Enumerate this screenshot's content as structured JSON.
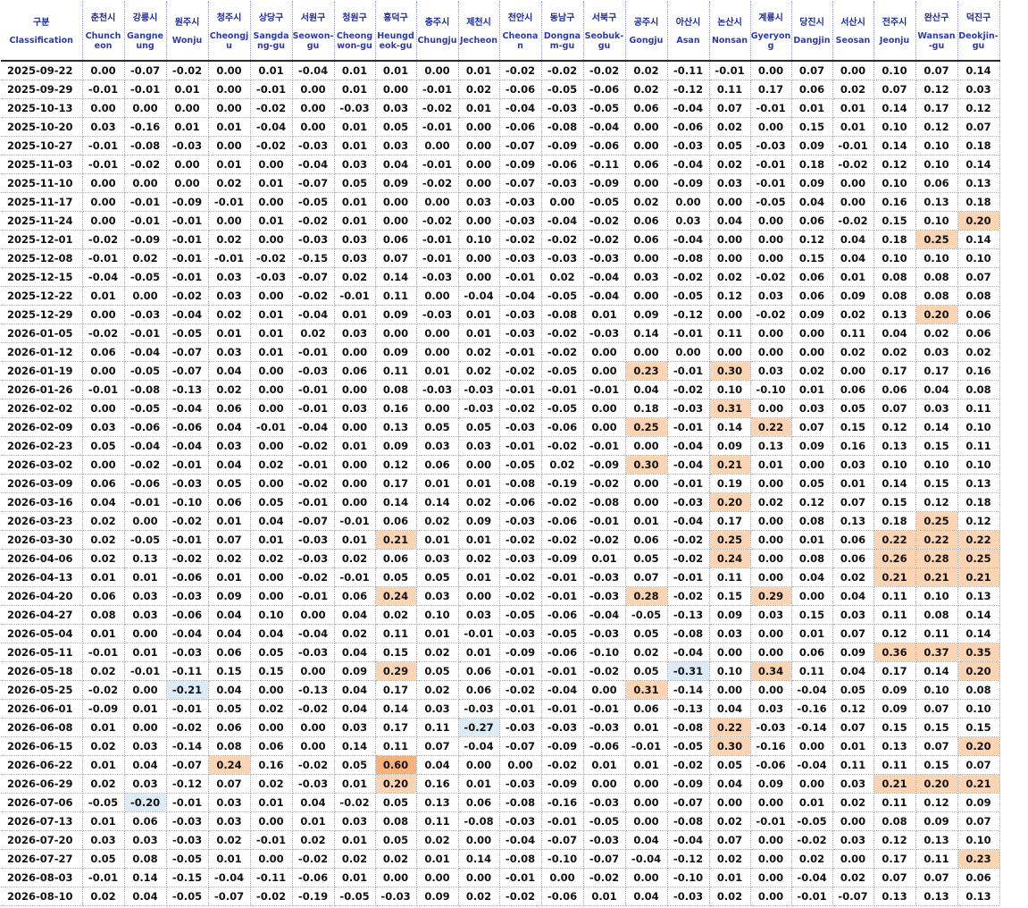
{
  "table": {
    "columns": [
      {
        "ko": "구분",
        "en": "Classification"
      },
      {
        "ko": "춘천시",
        "en": "Chuncheon"
      },
      {
        "ko": "강릉시",
        "en": "Gangneung"
      },
      {
        "ko": "원주시",
        "en": "Wonju"
      },
      {
        "ko": "청주시",
        "en": "Cheongju"
      },
      {
        "ko": "상당구",
        "en": "Sangdang-gu"
      },
      {
        "ko": "서원구",
        "en": "Seowon-gu"
      },
      {
        "ko": "청원구",
        "en": "Cheongwon-gu"
      },
      {
        "ko": "흥덕구",
        "en": "Heungdeok-gu"
      },
      {
        "ko": "충주시",
        "en": "Chungju"
      },
      {
        "ko": "제천시",
        "en": "Jecheon"
      },
      {
        "ko": "천안시",
        "en": "Cheonan"
      },
      {
        "ko": "동남구",
        "en": "Dongnam-gu"
      },
      {
        "ko": "서북구",
        "en": "Seobuk-gu"
      },
      {
        "ko": "공주시",
        "en": "Gongju"
      },
      {
        "ko": "아산시",
        "en": "Asan"
      },
      {
        "ko": "논산시",
        "en": "Nonsan"
      },
      {
        "ko": "계룡시",
        "en": "Gyeryong"
      },
      {
        "ko": "당진시",
        "en": "Dangjin"
      },
      {
        "ko": "서산시",
        "en": "Seosan"
      },
      {
        "ko": "전주시",
        "en": "Jeonju"
      },
      {
        "ko": "완산구",
        "en": "Wansan-gu"
      },
      {
        "ko": "덕진구",
        "en": "Deokjin-gu"
      }
    ],
    "rows": [
      [
        "2025-09-22",
        "0.00",
        "-0.07",
        "-0.02",
        "0.00",
        "0.01",
        "-0.04",
        "0.01",
        "0.01",
        "0.00",
        "0.01",
        "-0.02",
        "-0.02",
        "-0.02",
        "0.02",
        "-0.11",
        "-0.01",
        "0.00",
        "0.07",
        "0.00",
        "0.10",
        "0.07",
        "0.14"
      ],
      [
        "2025-09-29",
        "-0.01",
        "-0.01",
        "0.01",
        "0.00",
        "-0.01",
        "0.00",
        "0.01",
        "0.00",
        "-0.01",
        "0.02",
        "-0.06",
        "-0.05",
        "-0.06",
        "0.02",
        "-0.12",
        "0.11",
        "0.17",
        "0.06",
        "0.02",
        "0.07",
        "0.12",
        "0.03"
      ],
      [
        "2025-10-13",
        "0.00",
        "0.00",
        "0.00",
        "0.00",
        "-0.02",
        "0.00",
        "-0.03",
        "0.03",
        "-0.02",
        "0.01",
        "-0.04",
        "-0.03",
        "-0.05",
        "0.06",
        "-0.04",
        "0.07",
        "-0.01",
        "0.01",
        "0.01",
        "0.14",
        "0.17",
        "0.12"
      ],
      [
        "2025-10-20",
        "0.03",
        "-0.16",
        "0.01",
        "0.01",
        "-0.04",
        "0.00",
        "0.01",
        "0.05",
        "-0.01",
        "0.00",
        "-0.06",
        "-0.08",
        "-0.04",
        "0.00",
        "-0.06",
        "0.02",
        "0.00",
        "0.15",
        "0.01",
        "0.10",
        "0.12",
        "0.07"
      ],
      [
        "2025-10-27",
        "-0.01",
        "-0.08",
        "-0.03",
        "0.00",
        "-0.02",
        "-0.03",
        "0.01",
        "0.03",
        "0.00",
        "0.00",
        "-0.07",
        "-0.09",
        "-0.06",
        "0.00",
        "-0.03",
        "0.05",
        "-0.03",
        "0.09",
        "-0.01",
        "0.14",
        "0.10",
        "0.18"
      ],
      [
        "2025-11-03",
        "-0.01",
        "-0.02",
        "0.00",
        "0.01",
        "0.00",
        "-0.04",
        "0.03",
        "0.04",
        "-0.01",
        "0.00",
        "-0.09",
        "-0.06",
        "-0.11",
        "0.06",
        "-0.04",
        "0.02",
        "-0.01",
        "0.18",
        "-0.02",
        "0.12",
        "0.10",
        "0.14"
      ],
      [
        "2025-11-10",
        "0.00",
        "0.00",
        "0.00",
        "0.02",
        "0.01",
        "-0.07",
        "0.05",
        "0.09",
        "-0.02",
        "0.00",
        "-0.07",
        "-0.03",
        "-0.09",
        "0.00",
        "-0.09",
        "0.03",
        "-0.01",
        "0.09",
        "0.00",
        "0.10",
        "0.06",
        "0.13"
      ],
      [
        "2025-11-17",
        "0.00",
        "-0.01",
        "-0.09",
        "-0.01",
        "0.00",
        "-0.05",
        "0.01",
        "0.00",
        "0.00",
        "0.03",
        "-0.03",
        "0.00",
        "-0.05",
        "0.02",
        "0.00",
        "0.00",
        "-0.05",
        "0.04",
        "0.00",
        "0.16",
        "0.13",
        "0.18"
      ],
      [
        "2025-11-24",
        "0.00",
        "-0.01",
        "-0.01",
        "0.00",
        "0.01",
        "-0.02",
        "0.01",
        "0.00",
        "-0.02",
        "0.00",
        "-0.03",
        "-0.04",
        "-0.02",
        "0.06",
        "0.03",
        "0.04",
        "0.00",
        "0.06",
        "-0.02",
        "0.15",
        "0.10",
        "0.20"
      ],
      [
        "2025-12-01",
        "-0.02",
        "-0.09",
        "-0.01",
        "0.02",
        "0.00",
        "-0.03",
        "0.03",
        "0.06",
        "-0.01",
        "0.10",
        "-0.02",
        "-0.02",
        "-0.02",
        "0.06",
        "-0.04",
        "0.00",
        "0.00",
        "0.12",
        "0.04",
        "0.18",
        "0.25",
        "0.14"
      ],
      [
        "2025-12-08",
        "-0.01",
        "0.02",
        "-0.01",
        "-0.01",
        "-0.02",
        "-0.15",
        "0.03",
        "0.07",
        "-0.01",
        "0.00",
        "-0.03",
        "-0.03",
        "-0.03",
        "0.00",
        "-0.08",
        "0.00",
        "0.00",
        "0.15",
        "0.04",
        "0.10",
        "0.10",
        "0.10"
      ],
      [
        "2025-12-15",
        "-0.04",
        "-0.05",
        "-0.01",
        "0.03",
        "-0.03",
        "-0.07",
        "0.02",
        "0.14",
        "-0.03",
        "0.00",
        "-0.01",
        "0.02",
        "-0.04",
        "0.03",
        "-0.02",
        "0.02",
        "-0.02",
        "0.06",
        "0.01",
        "0.08",
        "0.08",
        "0.07"
      ],
      [
        "2025-12-22",
        "0.01",
        "0.00",
        "-0.02",
        "0.03",
        "0.00",
        "-0.02",
        "-0.01",
        "0.11",
        "0.00",
        "-0.04",
        "-0.04",
        "-0.05",
        "-0.04",
        "0.00",
        "-0.05",
        "0.12",
        "0.03",
        "0.06",
        "0.09",
        "0.08",
        "0.08",
        "0.08"
      ],
      [
        "2025-12-29",
        "0.00",
        "-0.03",
        "-0.04",
        "0.02",
        "0.01",
        "-0.04",
        "0.01",
        "0.09",
        "-0.03",
        "0.01",
        "-0.03",
        "-0.08",
        "0.01",
        "0.09",
        "-0.12",
        "0.00",
        "-0.02",
        "0.09",
        "0.02",
        "0.13",
        "0.20",
        "0.06"
      ],
      [
        "2026-01-05",
        "-0.02",
        "-0.01",
        "-0.05",
        "0.01",
        "0.01",
        "0.02",
        "0.03",
        "0.00",
        "0.00",
        "0.01",
        "-0.03",
        "-0.02",
        "-0.03",
        "0.14",
        "-0.01",
        "0.11",
        "0.00",
        "0.00",
        "0.11",
        "0.04",
        "0.02",
        "0.06"
      ],
      [
        "2026-01-12",
        "0.06",
        "-0.04",
        "-0.07",
        "0.03",
        "0.01",
        "-0.01",
        "0.00",
        "0.09",
        "0.00",
        "0.02",
        "-0.01",
        "-0.02",
        "0.00",
        "0.00",
        "0.00",
        "0.00",
        "0.00",
        "0.00",
        "0.02",
        "0.02",
        "0.03",
        "0.02"
      ],
      [
        "2026-01-19",
        "0.00",
        "-0.05",
        "-0.07",
        "0.04",
        "0.00",
        "-0.03",
        "0.06",
        "0.11",
        "0.01",
        "0.02",
        "-0.02",
        "-0.05",
        "0.00",
        "0.23",
        "-0.01",
        "0.30",
        "0.03",
        "0.02",
        "0.00",
        "0.17",
        "0.17",
        "0.16"
      ],
      [
        "2026-01-26",
        "-0.01",
        "-0.08",
        "-0.13",
        "0.02",
        "0.00",
        "-0.01",
        "0.00",
        "0.08",
        "-0.03",
        "-0.03",
        "-0.01",
        "-0.01",
        "-0.01",
        "0.04",
        "-0.02",
        "0.10",
        "-0.10",
        "0.01",
        "0.06",
        "0.06",
        "0.04",
        "0.08"
      ],
      [
        "2026-02-02",
        "0.00",
        "-0.05",
        "-0.04",
        "0.06",
        "0.00",
        "-0.01",
        "0.03",
        "0.16",
        "0.00",
        "-0.03",
        "-0.02",
        "-0.05",
        "0.00",
        "0.18",
        "-0.03",
        "0.31",
        "0.00",
        "0.03",
        "0.05",
        "0.07",
        "0.03",
        "0.11"
      ],
      [
        "2026-02-09",
        "0.03",
        "-0.06",
        "-0.06",
        "0.04",
        "-0.01",
        "-0.04",
        "0.00",
        "0.13",
        "0.05",
        "0.05",
        "-0.03",
        "-0.06",
        "0.00",
        "0.25",
        "-0.01",
        "0.14",
        "0.22",
        "0.07",
        "0.15",
        "0.12",
        "0.14",
        "0.10"
      ],
      [
        "2026-02-23",
        "0.05",
        "-0.04",
        "-0.04",
        "0.03",
        "0.00",
        "-0.02",
        "0.01",
        "0.09",
        "0.03",
        "0.03",
        "-0.01",
        "-0.02",
        "-0.01",
        "0.00",
        "-0.04",
        "0.09",
        "0.13",
        "0.09",
        "0.16",
        "0.13",
        "0.15",
        "0.11"
      ],
      [
        "2026-03-02",
        "0.00",
        "-0.02",
        "-0.01",
        "0.04",
        "0.02",
        "-0.01",
        "0.00",
        "0.12",
        "0.06",
        "0.00",
        "-0.05",
        "0.02",
        "-0.09",
        "0.30",
        "-0.04",
        "0.21",
        "0.01",
        "0.00",
        "0.03",
        "0.10",
        "0.10",
        "0.10"
      ],
      [
        "2026-03-09",
        "0.06",
        "-0.06",
        "-0.03",
        "0.05",
        "0.00",
        "-0.02",
        "0.00",
        "0.17",
        "0.01",
        "0.01",
        "-0.08",
        "-0.19",
        "-0.02",
        "0.00",
        "-0.01",
        "0.19",
        "0.00",
        "0.05",
        "0.01",
        "0.14",
        "0.15",
        "0.13"
      ],
      [
        "2026-03-16",
        "0.04",
        "-0.01",
        "-0.10",
        "0.06",
        "0.05",
        "-0.01",
        "0.00",
        "0.14",
        "0.14",
        "0.02",
        "-0.06",
        "-0.02",
        "-0.08",
        "0.00",
        "-0.03",
        "0.20",
        "0.02",
        "0.12",
        "0.07",
        "0.15",
        "0.12",
        "0.18"
      ],
      [
        "2026-03-23",
        "0.02",
        "0.00",
        "-0.02",
        "0.01",
        "0.04",
        "-0.07",
        "-0.01",
        "0.06",
        "0.02",
        "0.09",
        "-0.03",
        "-0.06",
        "-0.01",
        "0.01",
        "-0.04",
        "0.17",
        "0.00",
        "0.08",
        "0.13",
        "0.18",
        "0.25",
        "0.12"
      ],
      [
        "2026-03-30",
        "0.02",
        "-0.05",
        "-0.01",
        "0.07",
        "0.01",
        "-0.03",
        "0.01",
        "0.21",
        "0.01",
        "0.01",
        "-0.02",
        "-0.02",
        "-0.02",
        "0.06",
        "-0.02",
        "0.25",
        "0.00",
        "0.01",
        "0.06",
        "0.22",
        "0.22",
        "0.22"
      ],
      [
        "2026-04-06",
        "0.02",
        "0.13",
        "-0.02",
        "0.02",
        "0.02",
        "-0.03",
        "0.02",
        "0.06",
        "0.03",
        "0.02",
        "-0.03",
        "-0.09",
        "0.01",
        "0.05",
        "-0.02",
        "0.24",
        "0.00",
        "0.08",
        "0.06",
        "0.26",
        "0.28",
        "0.25"
      ],
      [
        "2026-04-13",
        "0.01",
        "0.01",
        "-0.06",
        "0.01",
        "0.00",
        "-0.02",
        "-0.01",
        "0.05",
        "0.05",
        "0.01",
        "-0.02",
        "-0.01",
        "-0.03",
        "0.07",
        "-0.01",
        "0.11",
        "0.00",
        "0.04",
        "0.02",
        "0.21",
        "0.21",
        "0.21"
      ],
      [
        "2026-04-20",
        "0.06",
        "0.03",
        "-0.03",
        "0.09",
        "0.00",
        "-0.01",
        "0.06",
        "0.24",
        "0.03",
        "0.00",
        "-0.02",
        "-0.01",
        "-0.03",
        "0.28",
        "-0.02",
        "0.15",
        "0.29",
        "0.00",
        "0.04",
        "0.11",
        "0.10",
        "0.13"
      ],
      [
        "2026-04-27",
        "0.08",
        "0.03",
        "-0.06",
        "0.04",
        "0.10",
        "0.00",
        "0.04",
        "0.02",
        "0.10",
        "0.03",
        "-0.05",
        "-0.06",
        "-0.04",
        "-0.05",
        "-0.13",
        "0.09",
        "0.03",
        "0.15",
        "0.03",
        "0.11",
        "0.08",
        "0.14"
      ],
      [
        "2026-05-04",
        "0.01",
        "0.00",
        "-0.04",
        "0.04",
        "0.04",
        "-0.04",
        "0.02",
        "0.11",
        "0.01",
        "-0.01",
        "-0.03",
        "-0.05",
        "-0.03",
        "0.05",
        "-0.08",
        "0.03",
        "0.00",
        "0.01",
        "0.07",
        "0.12",
        "0.11",
        "0.14"
      ],
      [
        "2026-05-11",
        "-0.01",
        "0.01",
        "-0.03",
        "0.06",
        "0.05",
        "-0.03",
        "0.04",
        "0.15",
        "0.02",
        "0.01",
        "-0.09",
        "-0.06",
        "-0.10",
        "0.02",
        "-0.04",
        "0.00",
        "0.00",
        "0.06",
        "0.09",
        "0.36",
        "0.37",
        "0.35"
      ],
      [
        "2026-05-18",
        "0.02",
        "-0.01",
        "-0.11",
        "0.15",
        "0.15",
        "0.00",
        "0.09",
        "0.29",
        "0.05",
        "0.06",
        "-0.01",
        "-0.01",
        "-0.02",
        "0.05",
        "-0.31",
        "0.10",
        "0.34",
        "0.11",
        "0.04",
        "0.17",
        "0.14",
        "0.20"
      ],
      [
        "2026-05-25",
        "-0.02",
        "0.00",
        "-0.21",
        "0.04",
        "0.00",
        "-0.13",
        "0.04",
        "0.17",
        "0.02",
        "0.06",
        "-0.02",
        "-0.04",
        "0.00",
        "0.31",
        "-0.14",
        "0.00",
        "0.00",
        "-0.04",
        "0.05",
        "0.09",
        "0.10",
        "0.08"
      ],
      [
        "2026-06-01",
        "-0.09",
        "0.01",
        "-0.01",
        "0.05",
        "0.02",
        "-0.02",
        "0.04",
        "0.14",
        "0.03",
        "-0.03",
        "-0.01",
        "-0.01",
        "-0.01",
        "0.06",
        "-0.13",
        "0.04",
        "0.03",
        "-0.16",
        "0.12",
        "0.09",
        "0.07",
        "0.10"
      ],
      [
        "2026-06-08",
        "0.01",
        "0.00",
        "-0.02",
        "0.06",
        "0.00",
        "0.00",
        "0.03",
        "0.17",
        "0.11",
        "-0.27",
        "-0.03",
        "-0.03",
        "-0.03",
        "0.01",
        "-0.08",
        "0.22",
        "-0.03",
        "-0.14",
        "0.07",
        "0.15",
        "0.15",
        "0.15"
      ],
      [
        "2026-06-15",
        "0.02",
        "0.03",
        "-0.14",
        "0.08",
        "0.06",
        "0.00",
        "0.14",
        "0.11",
        "0.07",
        "-0.04",
        "-0.07",
        "-0.09",
        "-0.06",
        "-0.01",
        "-0.05",
        "0.30",
        "-0.16",
        "0.00",
        "0.01",
        "0.13",
        "0.07",
        "0.20"
      ],
      [
        "2026-06-22",
        "0.01",
        "0.04",
        "-0.07",
        "0.24",
        "0.16",
        "-0.02",
        "0.05",
        "0.60",
        "0.04",
        "0.00",
        "0.00",
        "-0.02",
        "0.01",
        "0.01",
        "-0.02",
        "0.05",
        "-0.06",
        "-0.04",
        "0.11",
        "0.11",
        "0.15",
        "0.07"
      ],
      [
        "2026-06-29",
        "0.02",
        "0.03",
        "-0.12",
        "0.07",
        "0.02",
        "-0.03",
        "0.01",
        "0.20",
        "0.16",
        "0.01",
        "-0.03",
        "-0.09",
        "0.00",
        "0.00",
        "-0.09",
        "0.04",
        "0.09",
        "0.00",
        "0.03",
        "0.21",
        "0.20",
        "0.21"
      ],
      [
        "2026-07-06",
        "-0.05",
        "-0.20",
        "-0.01",
        "0.03",
        "0.01",
        "0.04",
        "-0.02",
        "0.05",
        "0.13",
        "0.06",
        "-0.08",
        "-0.16",
        "-0.03",
        "0.00",
        "-0.07",
        "0.00",
        "0.00",
        "0.01",
        "0.02",
        "0.11",
        "0.12",
        "0.09"
      ],
      [
        "2026-07-13",
        "0.01",
        "0.06",
        "-0.03",
        "0.03",
        "0.00",
        "0.01",
        "0.03",
        "0.08",
        "0.11",
        "-0.08",
        "-0.03",
        "-0.01",
        "-0.05",
        "0.00",
        "-0.08",
        "0.02",
        "-0.01",
        "-0.05",
        "0.00",
        "0.08",
        "0.09",
        "0.07"
      ],
      [
        "2026-07-20",
        "0.03",
        "0.03",
        "-0.03",
        "0.02",
        "-0.01",
        "0.02",
        "0.01",
        "0.05",
        "0.02",
        "0.00",
        "-0.04",
        "-0.07",
        "-0.03",
        "0.04",
        "-0.04",
        "0.07",
        "0.00",
        "-0.02",
        "0.03",
        "0.12",
        "0.13",
        "0.10"
      ],
      [
        "2026-07-27",
        "0.05",
        "0.08",
        "-0.05",
        "0.01",
        "0.00",
        "-0.02",
        "0.02",
        "0.02",
        "0.01",
        "0.14",
        "-0.08",
        "-0.10",
        "-0.07",
        "-0.04",
        "-0.12",
        "0.02",
        "0.00",
        "0.02",
        "0.00",
        "0.17",
        "0.11",
        "0.23"
      ],
      [
        "2026-08-03",
        "-0.01",
        "0.14",
        "-0.15",
        "-0.04",
        "-0.11",
        "-0.06",
        "0.01",
        "0.00",
        "0.00",
        "0.00",
        "-0.01",
        "0.00",
        "-0.02",
        "0.00",
        "-0.10",
        "0.01",
        "0.00",
        "-0.04",
        "0.02",
        "0.07",
        "0.07",
        "0.06"
      ],
      [
        "2026-08-10",
        "0.02",
        "0.04",
        "-0.05",
        "-0.07",
        "-0.02",
        "-0.19",
        "-0.05",
        "-0.03",
        "0.09",
        "0.02",
        "-0.02",
        "-0.06",
        "0.01",
        "0.04",
        "-0.03",
        "0.02",
        "0.00",
        "-0.01",
        "-0.07",
        "0.13",
        "0.13",
        "0.13"
      ]
    ]
  },
  "highlight_colors": {
    "high": "#fbd4b4",
    "very_high": "#f7b27a",
    "low": "#ddebf7"
  }
}
